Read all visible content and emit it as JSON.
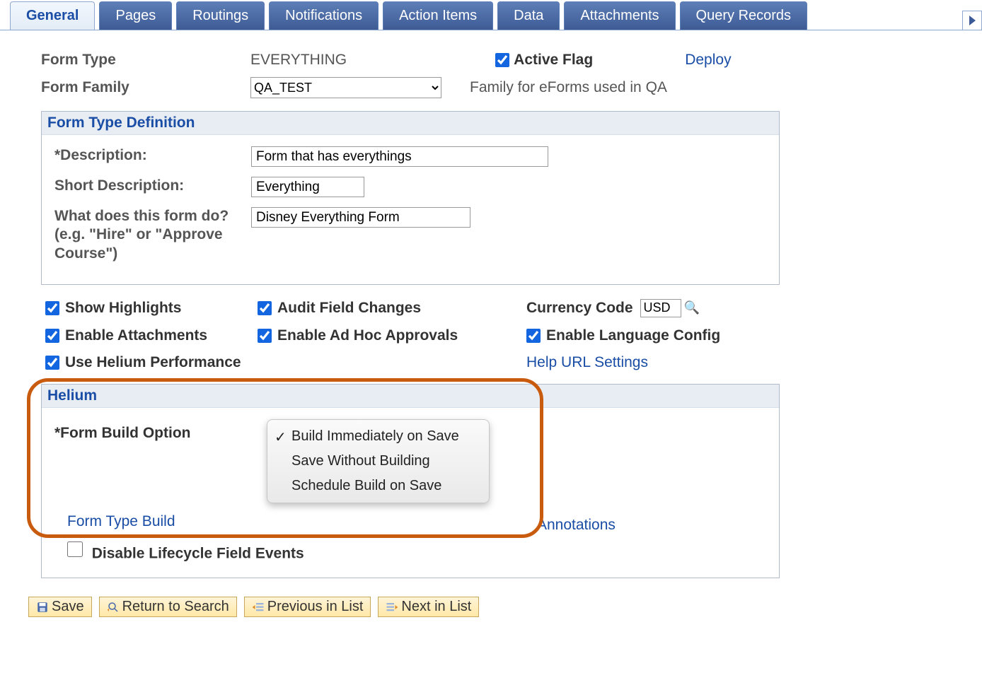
{
  "tabs": {
    "t0": "General",
    "t1": "Pages",
    "t2": "Routings",
    "t3": "Notifications",
    "t4": "Action Items",
    "t5": "Data",
    "t6": "Attachments",
    "t7": "Query Records"
  },
  "top": {
    "form_type_label": "Form Type",
    "form_type_value": "EVERYTHING",
    "active_flag_label": "Active Flag",
    "deploy_label": "Deploy",
    "form_family_label": "Form Family",
    "form_family_value": "QA_TEST",
    "form_family_desc": "Family for eForms used in QA"
  },
  "definition": {
    "title": "Form Type Definition",
    "desc_label": "*Description:",
    "desc_value": "Form that has everythings",
    "short_label": "Short Description:",
    "short_value": "Everything",
    "whatdo_label": "What does this form do? (e.g. \"Hire\" or \"Approve Course\")",
    "whatdo_value": "Disney Everything Form"
  },
  "checks": {
    "show_highlights": "Show Highlights",
    "audit_field_changes": "Audit Field Changes",
    "currency_code_label": "Currency Code",
    "currency_code_value": "USD",
    "enable_attachments": "Enable Attachments",
    "enable_adhoc": "Enable Ad Hoc Approvals",
    "enable_lang": "Enable Language Config",
    "use_helium": "Use Helium Performance",
    "help_url": "Help URL Settings"
  },
  "helium": {
    "title": "Helium",
    "fbo_label": "*Form Build Option",
    "options": {
      "o0": "Build Immediately on Save",
      "o1": "Save Without Building",
      "o2": "Schedule Build on Save"
    },
    "form_type_build": "Form Type Build",
    "annotations": "Annotations",
    "disable_life": "Disable Lifecycle Field Events"
  },
  "buttons": {
    "save": "Save",
    "return": "Return to Search",
    "prev": "Previous in List",
    "next": "Next in List"
  }
}
